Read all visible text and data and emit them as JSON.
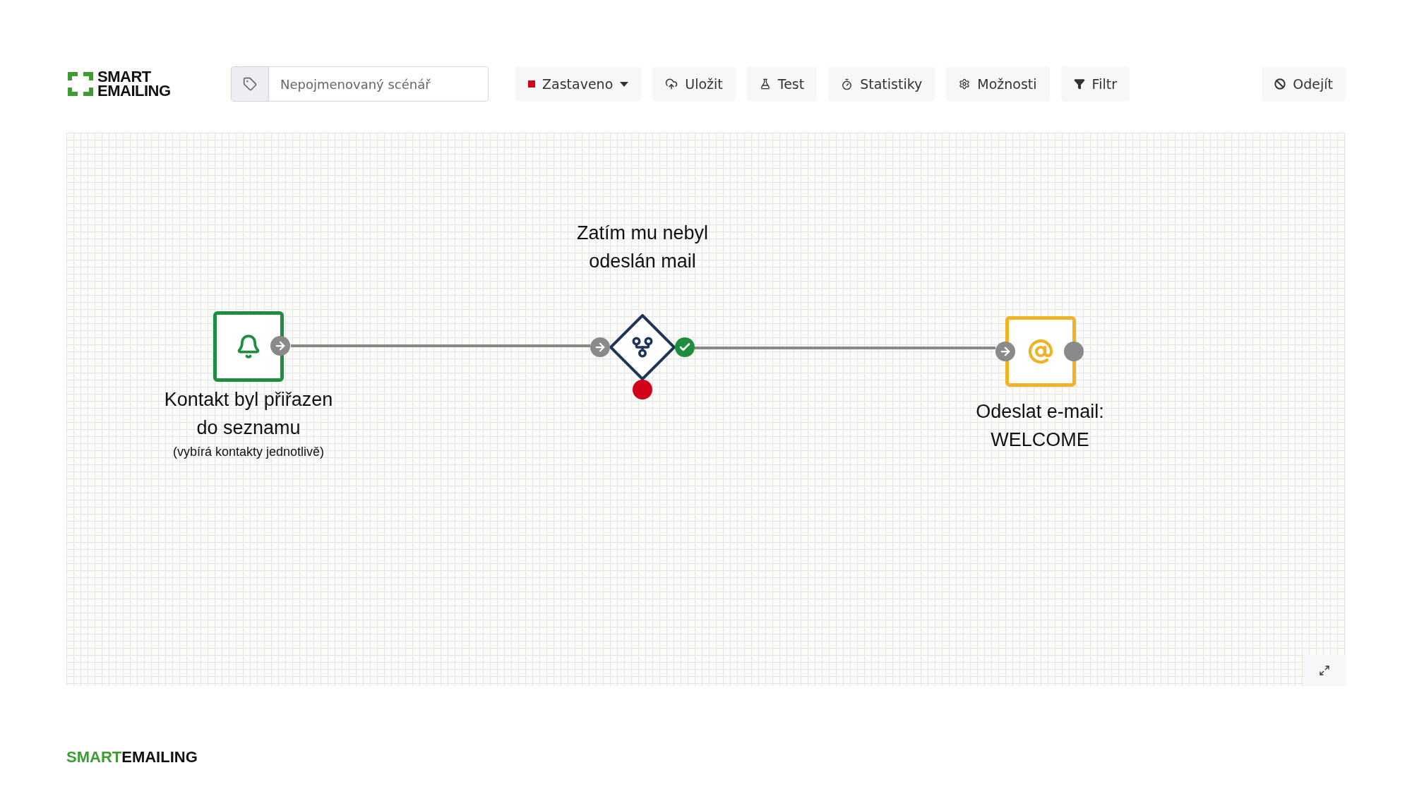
{
  "logo": {
    "line1": "SMART",
    "line2": "EMAILING"
  },
  "scenario_name": {
    "placeholder": "Nepojmenovaný scénář"
  },
  "toolbar": [
    {
      "kind": "status",
      "label": "Zastaveno",
      "color": "#d0021b"
    },
    {
      "kind": "save",
      "label": "Uložit"
    },
    {
      "kind": "test",
      "label": "Test"
    },
    {
      "kind": "stats",
      "label": "Statistiky"
    },
    {
      "kind": "options",
      "label": "Možnosti"
    },
    {
      "kind": "filter",
      "label": "Filtr"
    }
  ],
  "exit_button": {
    "label": "Odejít"
  },
  "canvas": {
    "nodes": [
      {
        "kind": "trigger",
        "title": "Kontakt byl přiřazen do seznamu",
        "note": "(vybírá kontakty jednotlivě)"
      },
      {
        "kind": "condition",
        "title": "Zatím mu nebyl odeslán mail"
      },
      {
        "kind": "email",
        "title": "Odeslat e-mail: WELCOME"
      }
    ]
  },
  "footer": {
    "brand_first": "SMART",
    "brand_second": "EMAILING"
  }
}
